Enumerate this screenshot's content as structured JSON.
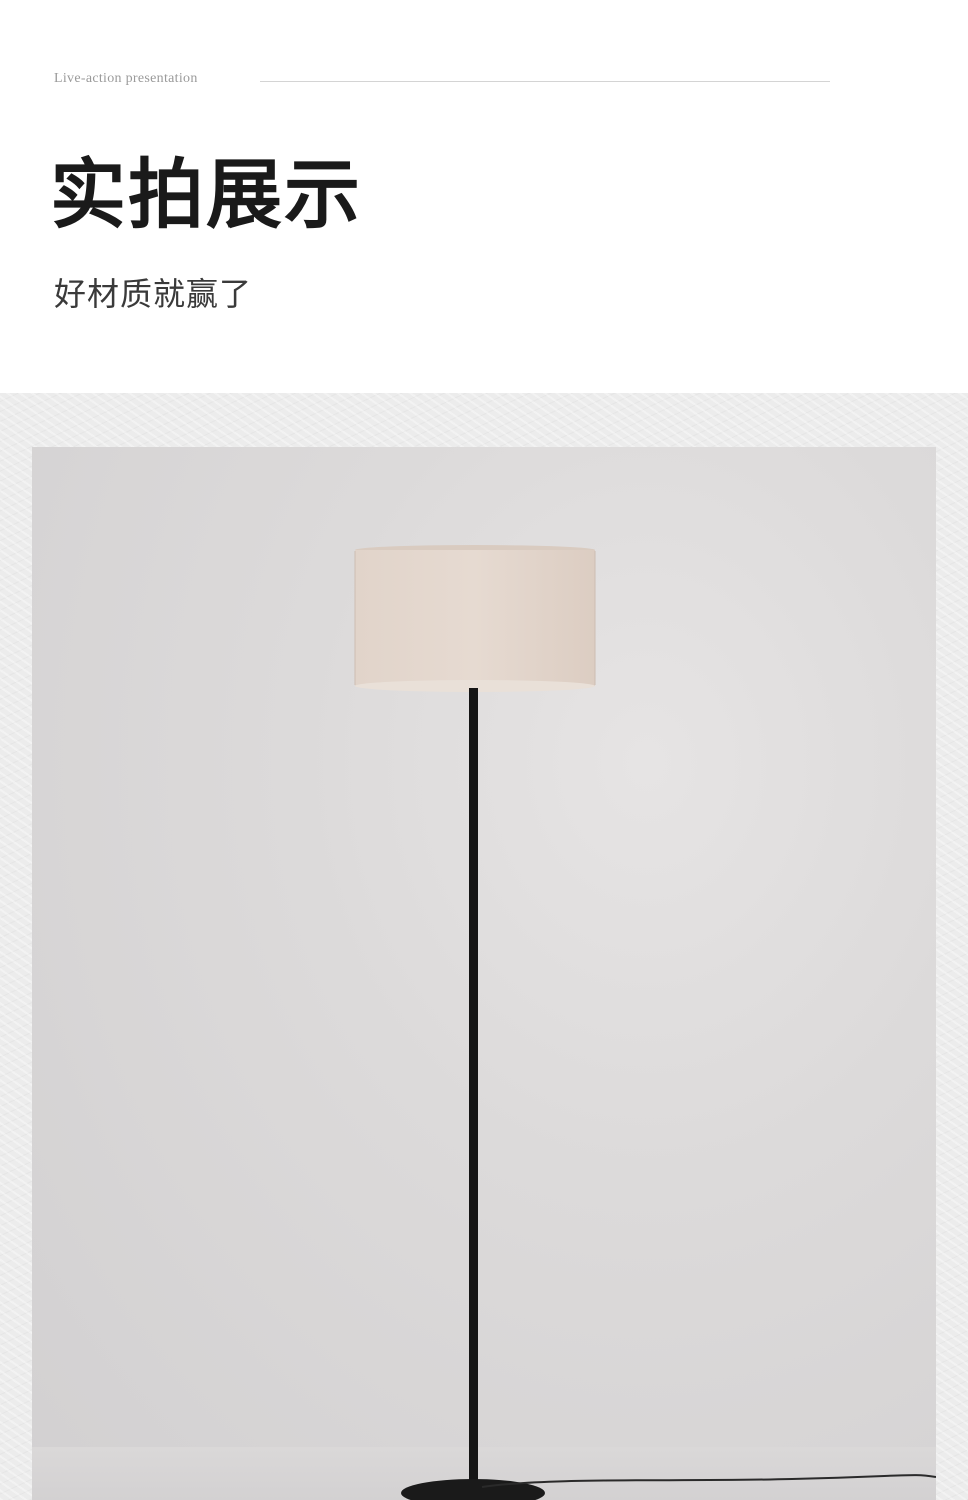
{
  "header": {
    "eyebrow": "Live-action presentation",
    "title": "实拍展示",
    "subtitle": "好材质就赢了"
  },
  "photo": {
    "subject_icon": "floor-lamp-icon",
    "colors": {
      "wall": "#d8d6d6",
      "shade": "#e3d6cc",
      "pole": "#151515"
    }
  }
}
